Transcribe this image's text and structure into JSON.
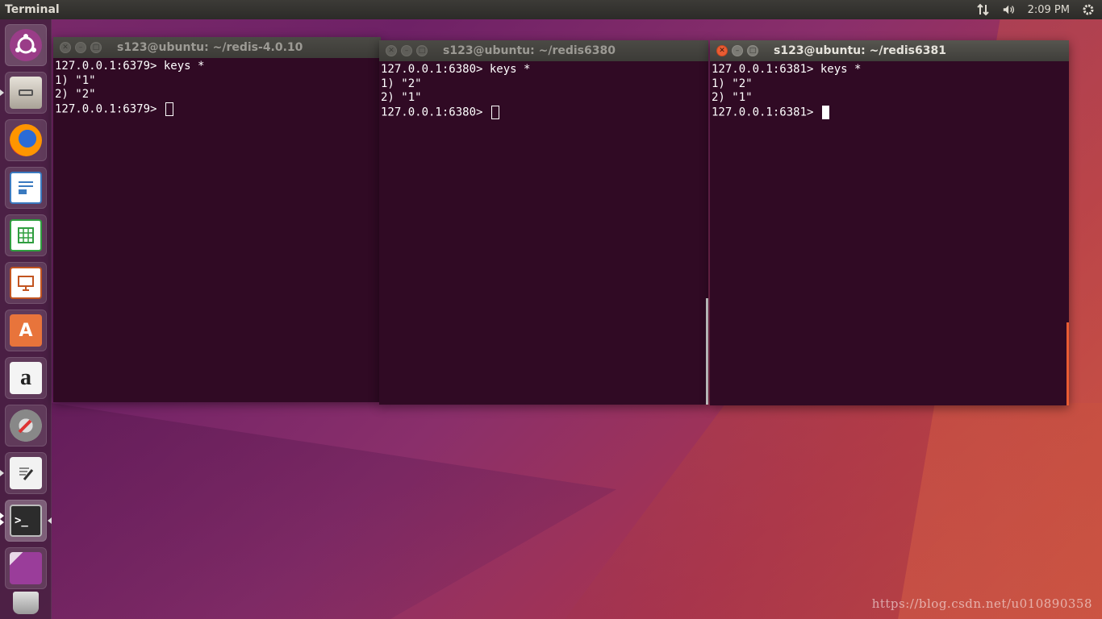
{
  "top_panel": {
    "app_title": "Terminal",
    "clock": "2:09 PM",
    "indicators": [
      "network-icon",
      "volume-icon",
      "gear-icon"
    ]
  },
  "launcher": {
    "items": [
      {
        "name": "ubuntu-logo-icon",
        "color": "#e95420"
      },
      {
        "name": "files-icon",
        "color": "#b8b2a8"
      },
      {
        "name": "firefox-icon",
        "color": "#e66000"
      },
      {
        "name": "libreoffice-writer-icon",
        "color": "#3a7ac0"
      },
      {
        "name": "libreoffice-calc-icon",
        "color": "#2f9e3f"
      },
      {
        "name": "libreoffice-impress-icon",
        "color": "#c2541f"
      },
      {
        "name": "software-center-icon",
        "color": "#e8743b"
      },
      {
        "name": "amazon-icon",
        "color": "#ffffff"
      },
      {
        "name": "system-settings-icon",
        "color": "#888888"
      },
      {
        "name": "text-editor-icon",
        "color": "#dcdcdc"
      },
      {
        "name": "terminal-icon",
        "color": "#2c2c2c"
      },
      {
        "name": "workspace-switcher-icon",
        "color": "#8a3a8a"
      },
      {
        "name": "trash-icon",
        "color": "#cfcfcf"
      }
    ]
  },
  "windows": [
    {
      "title": "s123@ubuntu: ~/redis-4.0.10",
      "lines": [
        "127.0.0.1:6379> keys *",
        "1) \"1\"",
        "2) \"2\"",
        "127.0.0.1:6379> "
      ]
    },
    {
      "title": "s123@ubuntu: ~/redis6380",
      "lines": [
        "127.0.0.1:6380> keys *",
        "1) \"2\"",
        "2) \"1\"",
        "127.0.0.1:6380> "
      ]
    },
    {
      "title": "s123@ubuntu: ~/redis6381",
      "lines": [
        "127.0.0.1:6381> keys *",
        "1) \"2\"",
        "2) \"1\"",
        "127.0.0.1:6381> "
      ]
    }
  ],
  "watermark": "https://blog.csdn.net/u010890358",
  "colors": {
    "terminal_bg": "#300a24",
    "close_active": "#e95c33",
    "panel_bg": "#3c3b37"
  }
}
